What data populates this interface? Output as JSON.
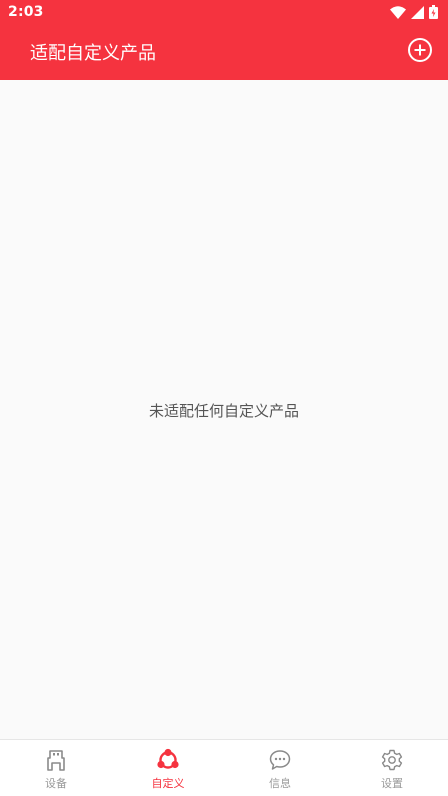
{
  "status_bar": {
    "time": "2:03",
    "icons": [
      "wifi-icon",
      "cell-signal-icon",
      "battery-icon"
    ]
  },
  "app_bar": {
    "title": "适配自定义产品",
    "action_icon": "add-circle-icon"
  },
  "main": {
    "empty_message": "未适配任何自定义产品"
  },
  "bottom_nav": {
    "items": [
      {
        "label": "设备",
        "icon": "usb-device-icon",
        "active": false
      },
      {
        "label": "自定义",
        "icon": "custom-nodes-icon",
        "active": true
      },
      {
        "label": "信息",
        "icon": "chat-bubble-icon",
        "active": false
      },
      {
        "label": "设置",
        "icon": "gear-icon",
        "active": false
      }
    ]
  },
  "colors": {
    "primary": "#f5333f",
    "background": "#fafafa",
    "nav_inactive": "#999999",
    "empty_text": "#555555"
  }
}
